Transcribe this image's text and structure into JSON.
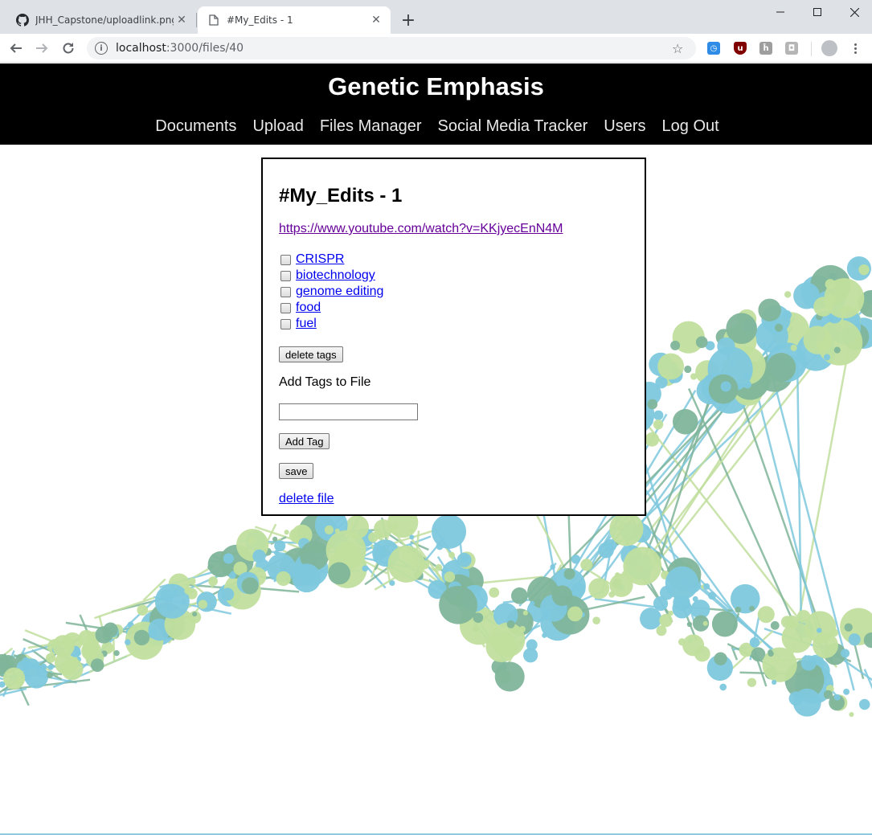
{
  "browser": {
    "tabs": [
      {
        "title": "JHH_Capstone/uploadlink.png at",
        "icon": "github-icon",
        "active": false
      },
      {
        "title": "#My_Edits - 1",
        "icon": "page-icon",
        "active": true
      }
    ],
    "url_host": "localhost",
    "url_path": ":3000/files/40",
    "extensions": [
      "clock-extension-icon",
      "ublock-icon",
      "hackernews-extension-icon",
      "bag-extension-icon"
    ]
  },
  "header": {
    "site_title": "Genetic Emphasis",
    "nav": [
      "Documents",
      "Upload",
      "Files Manager",
      "Social Media Tracker",
      "Users",
      "Log Out"
    ]
  },
  "file": {
    "title": "#My_Edits - 1",
    "link": "https://www.youtube.com/watch?v=KKjyecEnN4M",
    "tags": [
      "CRISPR",
      "biotechnology",
      "genome editing",
      "food",
      "fuel"
    ],
    "delete_tags_label": "delete tags",
    "add_tags_label": "Add Tags to File",
    "tag_input_value": "",
    "add_tag_label": "Add Tag",
    "save_label": "save",
    "delete_file_label": "delete file"
  },
  "colors": {
    "header_bg": "#000000",
    "node_blue": "#7ec8de",
    "node_green": "#c1df9e",
    "node_teal": "#7fb59a",
    "link_color": "#0000ee",
    "visited_link": "#660099"
  }
}
